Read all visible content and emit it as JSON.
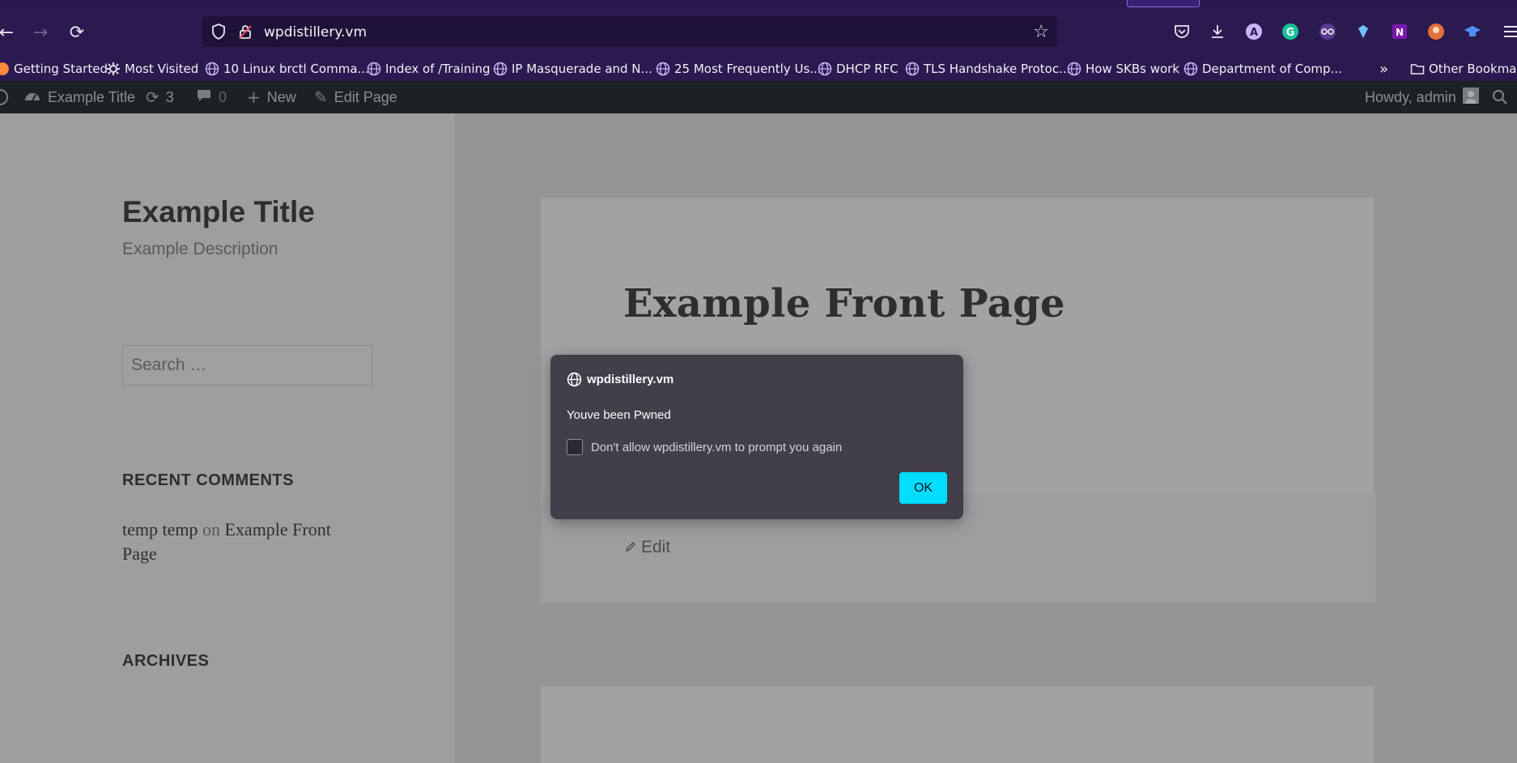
{
  "browser": {
    "url": "wpdistillery.vm",
    "bookmarks": [
      "Getting Started",
      "Most Visited",
      "10 Linux brctl Comma...",
      "Index of /Training",
      "IP Masquerade and N...",
      "25 Most Frequently Us...",
      "DHCP RFC",
      "TLS Handshake Protoc...",
      "How SKBs work",
      "Department of Comp...",
      "Other Bookmarks"
    ],
    "accent_color": "#2b1a4f"
  },
  "admin_bar": {
    "site_name": "Example Title",
    "updates_count": "3",
    "comments_count": "0",
    "new_label": "New",
    "edit_page_label": "Edit Page",
    "howdy": "Howdy, admin"
  },
  "sidebar": {
    "site_title": "Example Title",
    "site_description": "Example Description",
    "search_placeholder": "Search …",
    "recent_comments_heading": "RECENT COMMENTS",
    "recent_comment": {
      "author": "temp temp",
      "on": "on",
      "post": "Example Front Page"
    },
    "archives_heading": "ARCHIVES"
  },
  "main": {
    "page_title": "Example Front Page",
    "edit_label": "Edit"
  },
  "dialog": {
    "origin": "wpdistillery.vm",
    "message": "Youve been Pwned",
    "checkbox_label": "Don't allow wpdistillery.vm to prompt you again",
    "ok_label": "OK",
    "ok_color": "#00ddff"
  }
}
